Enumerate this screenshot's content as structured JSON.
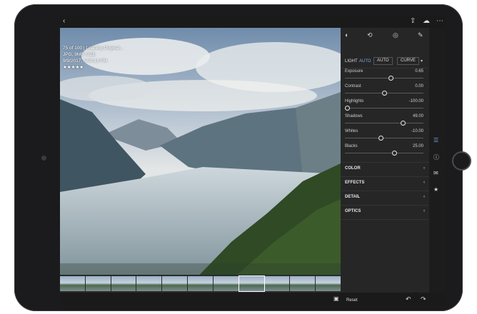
{
  "overlay": {
    "line1": "75 of 100 | Loading Original...",
    "line2": "JPG, 9MB SIZE",
    "line3": "9/9/2017, 5:08:13 PM",
    "rating": "★★★★★"
  },
  "panel": {
    "tabs": {
      "light": "LIGHT",
      "auto_badge": "AUTO",
      "auto": "AUTO",
      "curve": "CURVE"
    },
    "sliders": [
      {
        "label": "Exposure",
        "value": "0.65",
        "level": 0.58
      },
      {
        "label": "Contrast",
        "value": "0.00",
        "level": 0.5
      },
      {
        "label": "Highlights",
        "value": "-100.00",
        "level": 0.03
      },
      {
        "label": "Shadows",
        "value": "49.00",
        "level": 0.74
      },
      {
        "label": "Whites",
        "value": "-10.00",
        "level": 0.45
      },
      {
        "label": "Blacks",
        "value": "25.00",
        "level": 0.63
      }
    ],
    "sections": [
      "COLOR",
      "EFFECTS",
      "DETAIL",
      "OPTICS"
    ]
  },
  "bottom": {
    "reset": "Reset"
  },
  "icons": {
    "back": "chevron-left-icon",
    "share": "share-icon",
    "cloud": "cloud-icon",
    "more": "more-icon"
  }
}
